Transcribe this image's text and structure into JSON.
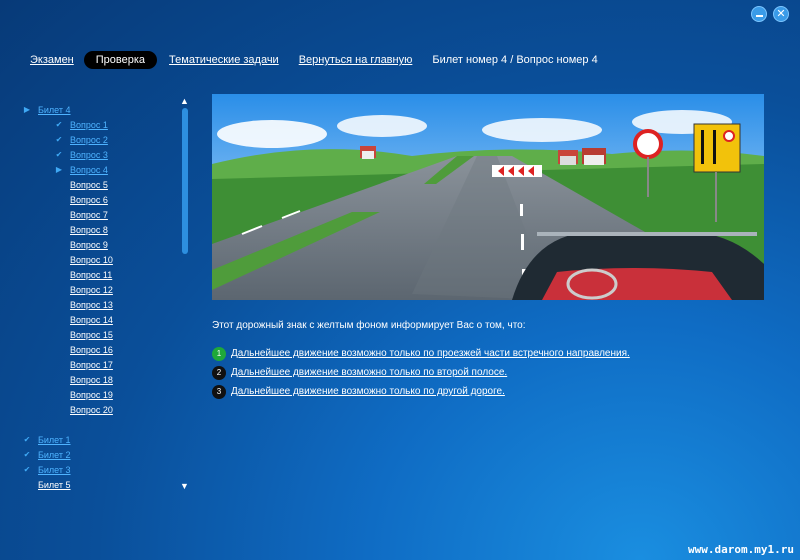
{
  "window": {
    "minimize_icon": "minimize-icon",
    "close_icon": "close-icon",
    "close_glyph": "✕"
  },
  "nav": {
    "exam": "Экзамен",
    "check": "Проверка",
    "topics": "Тематические задачи",
    "home": "Вернуться на главную",
    "ticket_info": "Билет номер 4 / Вопрос номер 4"
  },
  "sidebar": {
    "scroll_up": "▲",
    "scroll_down": "▼",
    "current_ticket": "Билет 4",
    "questions": [
      {
        "label": "Вопрос 1",
        "mark": "✔",
        "state": "done"
      },
      {
        "label": "Вопрос 2",
        "mark": "✔",
        "state": "done"
      },
      {
        "label": "Вопрос 3",
        "mark": "✔",
        "state": "done"
      },
      {
        "label": "Вопрос 4",
        "mark": "▶",
        "state": "current"
      },
      {
        "label": "Вопрос 5",
        "mark": "",
        "state": "open"
      },
      {
        "label": "Вопрос 6",
        "mark": "",
        "state": "open"
      },
      {
        "label": "Вопрос 7",
        "mark": "",
        "state": "open"
      },
      {
        "label": "Вопрос 8",
        "mark": "",
        "state": "open"
      },
      {
        "label": "Вопрос 9",
        "mark": "",
        "state": "open"
      },
      {
        "label": "Вопрос 10",
        "mark": "",
        "state": "open"
      },
      {
        "label": "Вопрос 11",
        "mark": "",
        "state": "open"
      },
      {
        "label": "Вопрос 12",
        "mark": "",
        "state": "open"
      },
      {
        "label": "Вопрос 13",
        "mark": "",
        "state": "open"
      },
      {
        "label": "Вопрос 14",
        "mark": "",
        "state": "open"
      },
      {
        "label": "Вопрос 15",
        "mark": "",
        "state": "open"
      },
      {
        "label": "Вопрос 16",
        "mark": "",
        "state": "open"
      },
      {
        "label": "Вопрос 17",
        "mark": "",
        "state": "open"
      },
      {
        "label": "Вопрос 18",
        "mark": "",
        "state": "open"
      },
      {
        "label": "Вопрос 19",
        "mark": "",
        "state": "open"
      },
      {
        "label": "Вопрос 20",
        "mark": "",
        "state": "open"
      }
    ],
    "tickets": [
      {
        "label": "Билет 1",
        "mark": "✔",
        "state": "done"
      },
      {
        "label": "Билет 2",
        "mark": "✔",
        "state": "done"
      },
      {
        "label": "Билет 3",
        "mark": "✔",
        "state": "done"
      },
      {
        "label": "Билет 5",
        "mark": "",
        "state": "open"
      }
    ]
  },
  "question": {
    "text": "Этот дорожный знак с желтым фоном информирует Вас о том, что:",
    "answers": [
      {
        "num": "1",
        "text": "Дальнейшее движение возможно только по проезжей части встречного направления.",
        "correct": true
      },
      {
        "num": "2",
        "text": "Дальнейшее движение возможно только по второй полосе.",
        "correct": false
      },
      {
        "num": "3",
        "text": "Дальнейшее движение возможно только по другой дороге.",
        "correct": false
      }
    ]
  },
  "footer": {
    "site": "www.darom.my1.ru"
  },
  "colors": {
    "correct": "#1fa83a",
    "link_done": "#4eb3ff",
    "accent": "#3fa9f5"
  }
}
